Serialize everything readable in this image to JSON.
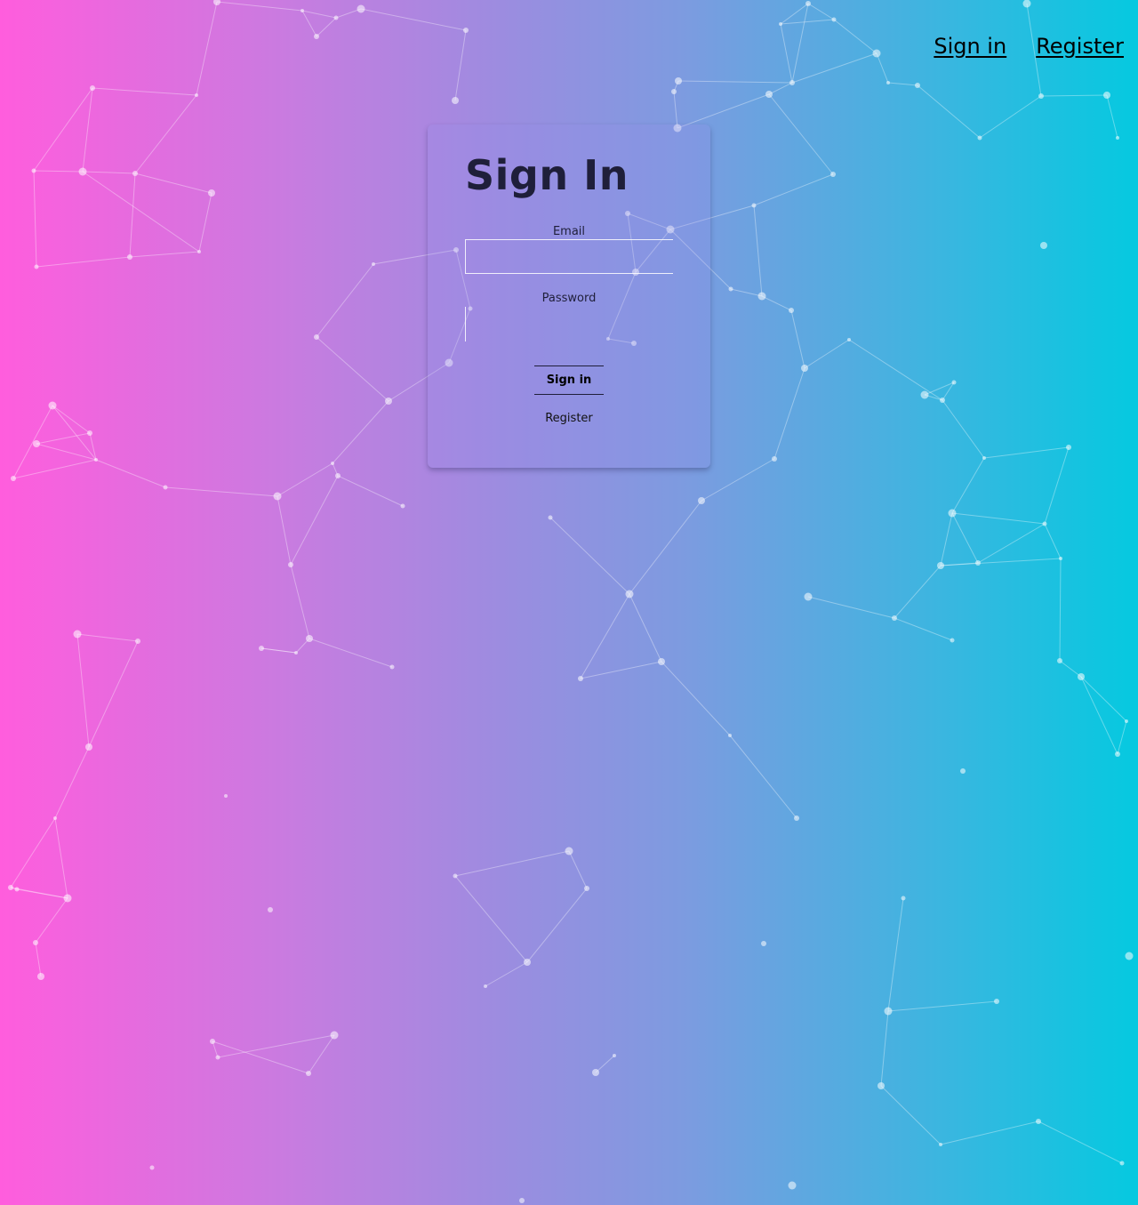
{
  "nav": {
    "signin_label": "Sign in",
    "register_label": "Register"
  },
  "form": {
    "title": "Sign In",
    "email_label": "Email",
    "email_value": "",
    "password_label": "Password",
    "password_value": "",
    "submit_label": "Sign in",
    "register_label": "Register"
  },
  "theme": {
    "gradient_start": "#ff5ddd",
    "gradient_end": "#05c9e0",
    "text_color": "#1f1f3a",
    "network_color": "#ffffff"
  }
}
